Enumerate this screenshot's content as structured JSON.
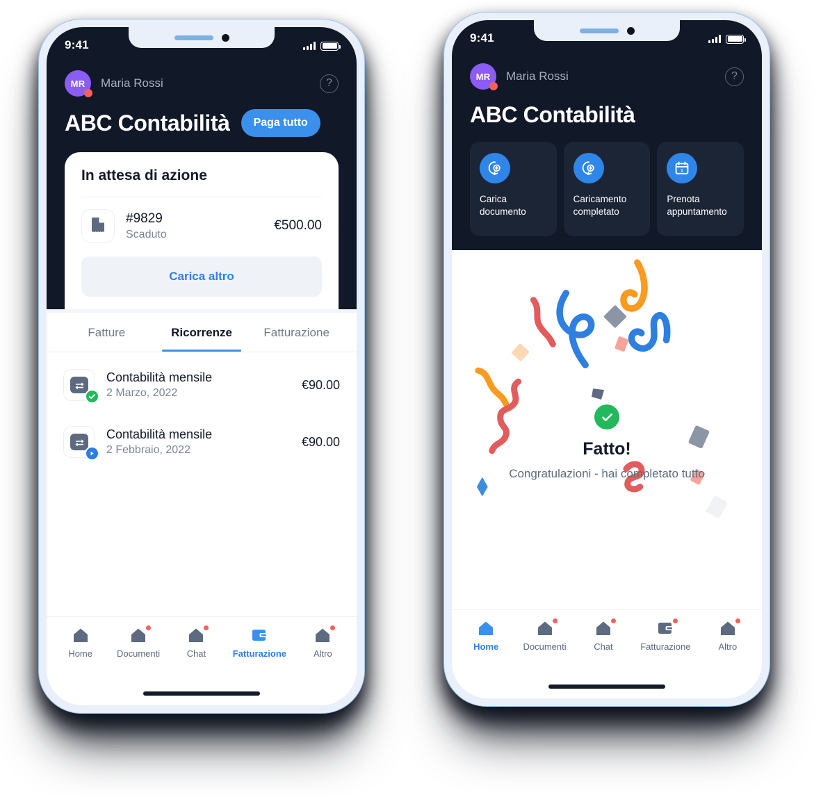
{
  "colors": {
    "header_bg": "#111828",
    "card_bg": "#1c2536",
    "accent_blue": "#3b90ec",
    "avatar_purple": "#8b5cf6",
    "badge_red": "#f2615a",
    "success_green": "#22b95c",
    "bezel": "#e9f0fa",
    "muted_text": "#7b8596",
    "slate_icon": "#5d6a80",
    "confetti_red": "#e15c5c",
    "confetti_orange": "#f99b20",
    "confetti_blue": "#2f7fe0",
    "confetti_gray": "#8b95a6",
    "confetti_peach": "#fbd9b4",
    "confetti_pink": "#f7a39a"
  },
  "phone_left": {
    "status_bar": {
      "time": "9:41",
      "signal_icon": "signal-bars-icon",
      "battery_icon": "battery-icon"
    },
    "header": {
      "avatar_initials": "MR",
      "user_name": "Maria Rossi",
      "help_icon": "question-circle-icon",
      "org_title": "ABC Contabilità",
      "pay_all_label": "Paga tutto"
    },
    "pending": {
      "title": "In attesa di azione",
      "invoice": {
        "icon": "document-icon",
        "id": "#9829",
        "status": "Scaduto",
        "amount": "€500.00"
      },
      "load_more_label": "Carica altro"
    },
    "tabs": [
      {
        "label": "Fatture",
        "active": false
      },
      {
        "label": "Ricorrenze",
        "active": true
      },
      {
        "label": "Fatturazione",
        "active": false
      }
    ],
    "recurring": [
      {
        "icon": "recurring-icon",
        "badge": "check-badge-icon",
        "name": "Contabilità mensile",
        "date": "2 Marzo, 2022",
        "amount": "€90.00"
      },
      {
        "icon": "recurring-icon",
        "badge": "play-badge-icon",
        "name": "Contabilità mensile",
        "date": "2 Febbraio, 2022",
        "amount": "€90.00"
      }
    ],
    "bottom_nav": [
      {
        "label": "Home",
        "icon": "home-icon",
        "active": false,
        "dot": false
      },
      {
        "label": "Documenti",
        "icon": "home-icon",
        "active": false,
        "dot": true
      },
      {
        "label": "Chat",
        "icon": "home-icon",
        "active": false,
        "dot": true
      },
      {
        "label": "Fatturazione",
        "icon": "wallet-icon",
        "active": true,
        "dot": false
      },
      {
        "label": "Altro",
        "icon": "home-icon",
        "active": false,
        "dot": true
      }
    ]
  },
  "phone_right": {
    "status_bar": {
      "time": "9:41",
      "signal_icon": "signal-bars-icon",
      "battery_icon": "battery-icon"
    },
    "header": {
      "avatar_initials": "MR",
      "user_name": "Maria Rossi",
      "help_icon": "question-circle-icon",
      "org_title": "ABC Contabilità"
    },
    "action_cards": [
      {
        "icon": "chat-plus-icon",
        "label": "Carica documento"
      },
      {
        "icon": "chat-plus-icon",
        "label": "Caricamento completato"
      },
      {
        "icon": "calendar-icon",
        "label": "Prenota appuntamento"
      }
    ],
    "success": {
      "check_icon": "check-circle-icon",
      "title": "Fatto!",
      "subtitle": "Congratulazioni - hai completato tutto"
    },
    "bottom_nav": [
      {
        "label": "Home",
        "icon": "home-icon",
        "active": true,
        "dot": false
      },
      {
        "label": "Documenti",
        "icon": "home-icon",
        "active": false,
        "dot": true
      },
      {
        "label": "Chat",
        "icon": "home-icon",
        "active": false,
        "dot": true
      },
      {
        "label": "Fatturazione",
        "icon": "wallet-icon",
        "active": false,
        "dot": true
      },
      {
        "label": "Altro",
        "icon": "home-icon",
        "active": false,
        "dot": true
      }
    ]
  }
}
